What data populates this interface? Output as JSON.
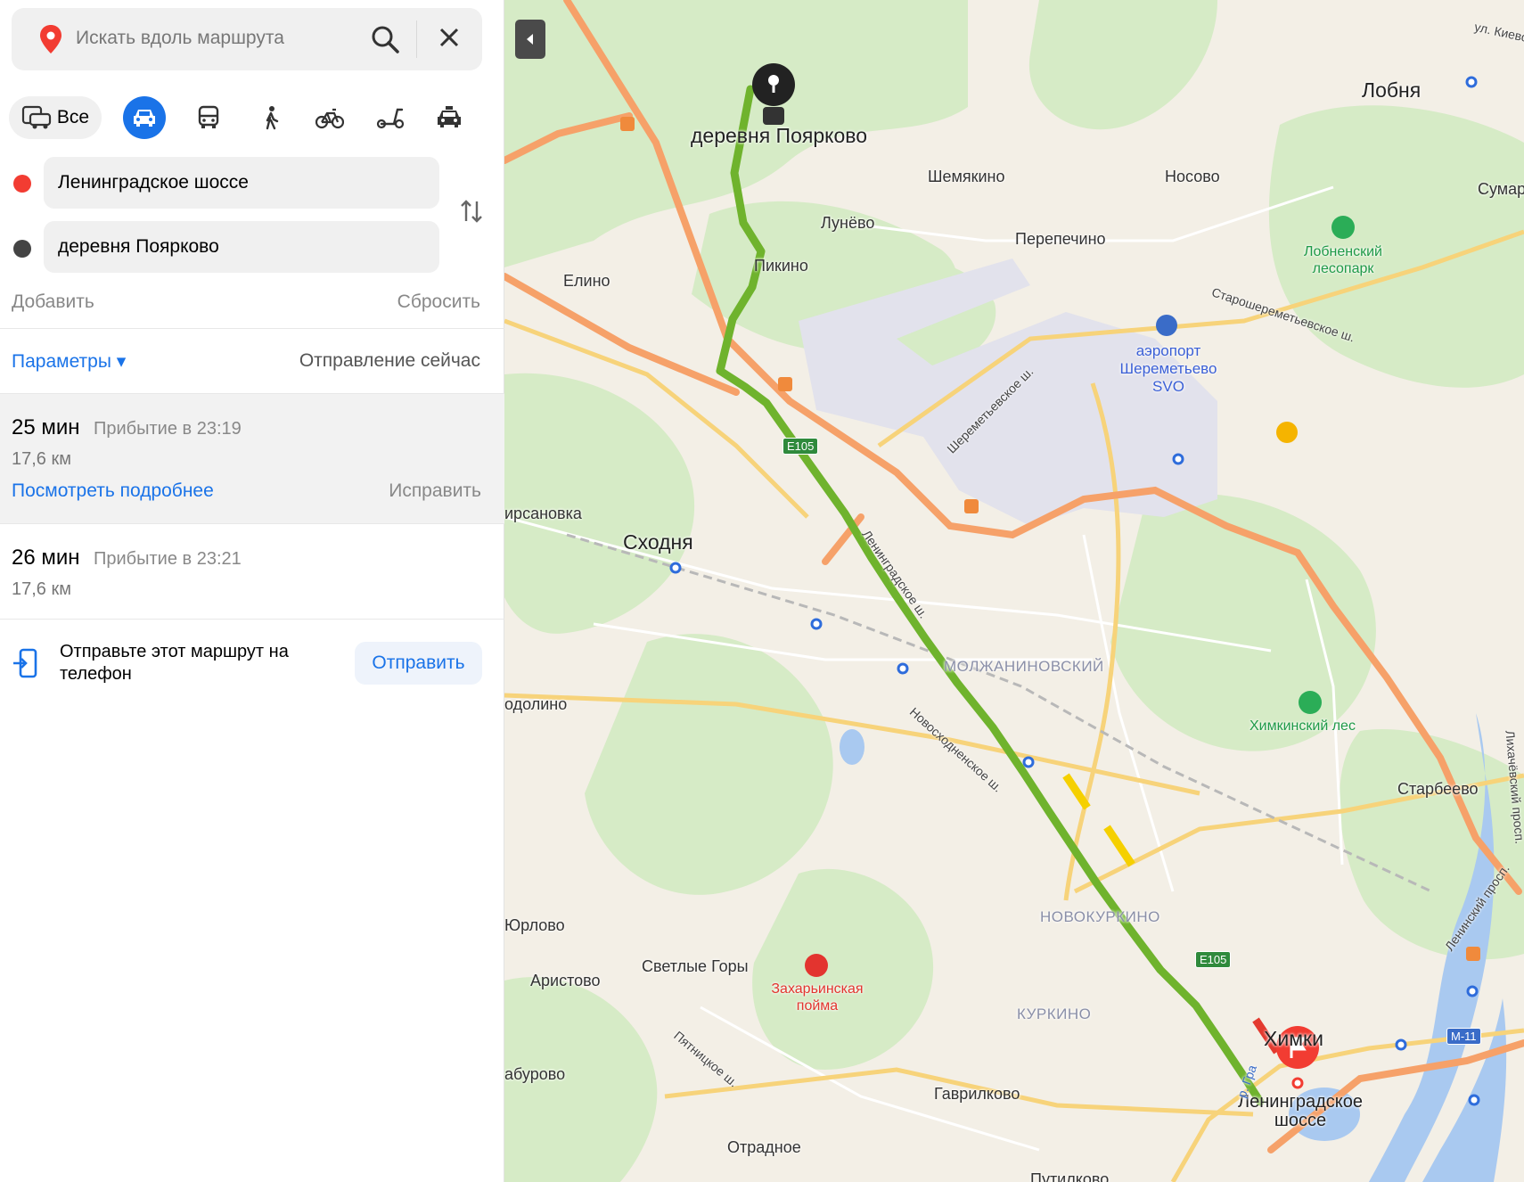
{
  "search": {
    "placeholder": "Искать вдоль маршрута"
  },
  "modes": {
    "all_label": "Все"
  },
  "route_points": {
    "from": "Ленинградское шоссе",
    "to": "деревня Поярково"
  },
  "actions": {
    "add": "Добавить",
    "reset": "Сбросить"
  },
  "params": {
    "label": "Параметры ▾",
    "departure": "Отправление сейчас"
  },
  "routes": [
    {
      "time": "25 мин",
      "arrival": "Прибытие в 23:19",
      "distance": "17,6 км",
      "details": "Посмотреть подробнее",
      "fix": "Исправить"
    },
    {
      "time": "26 мин",
      "arrival": "Прибытие в 23:21",
      "distance": "17,6 км"
    }
  ],
  "send": {
    "text": "Отправьте этот маршрут на телефон",
    "button": "Отправить"
  },
  "map": {
    "labels": {
      "poyarkovo": "деревня Поярково",
      "lobnya": "Лобня",
      "shemyakino": "Шемякино",
      "nosovo": "Носово",
      "lunevo": "Лунёво",
      "perepechino": "Перепечино",
      "pikino": "Пикино",
      "elino": "Елино",
      "skhodnya": "Сходня",
      "kirsanovka": "ирсановка",
      "molzhaninovsky": "МОЛЖАНИНОВСКИЙ",
      "odolino": "одолино",
      "yurlovo": "Юрлово",
      "aristovo": "Аристово",
      "svetlye_gory": "Светлые Горы",
      "aburovo": "абурово",
      "novokurkino": "НОВОКУРКИНО",
      "kurkino": "КУРКИНО",
      "gavrilkovo": "Гаврилково",
      "otradnoe": "Отрадное",
      "putilkovo": "Путилково",
      "khimki": "Химки",
      "starbeevo": "Старбеево",
      "sumar": "Сумар",
      "lobnya_forest": "Лобненский лесопарк",
      "khimki_forest": "Химкинский лес",
      "zakharino": "Захарьинская пойма",
      "airport": "аэропорт Шереметьево SVO",
      "leningradskoe": "Ленинградское шоссе",
      "ul_kievo": "ул. Киево",
      "road_leningr": "Ленинградское ш.",
      "road_novoskh": "Новосходненское ш.",
      "road_pyatn": "Пятницкое ш.",
      "road_sher": "Шереметьевское ш.",
      "road_staro": "Старошереметьевское ш.",
      "road_likh": "Лихачёвский просп.",
      "road_lenin": "Ленинский просп.",
      "road_graz": "р. Гра"
    },
    "shields": {
      "e105a": "E105",
      "e105b": "E105",
      "m11": "M-11"
    }
  }
}
